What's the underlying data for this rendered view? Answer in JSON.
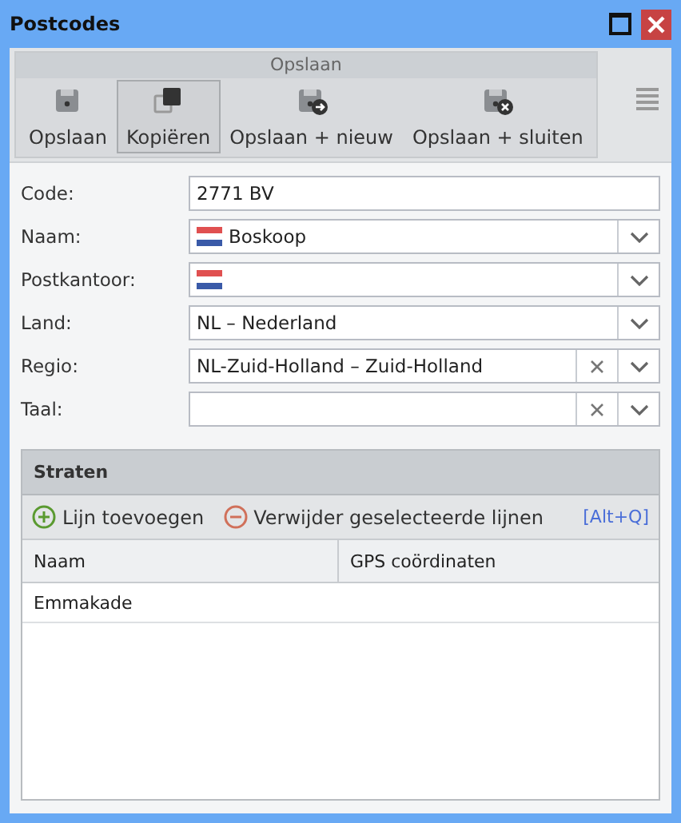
{
  "window": {
    "title": "Postcodes"
  },
  "toolbar": {
    "group_label": "Opslaan",
    "buttons": [
      {
        "label": "Opslaan",
        "kind": "save",
        "selected": false
      },
      {
        "label": "Kopiëren",
        "kind": "copy",
        "selected": true
      },
      {
        "label": "Opslaan + nieuw",
        "kind": "save_new",
        "selected": false
      },
      {
        "label": "Opslaan + sluiten",
        "kind": "save_close",
        "selected": false
      }
    ]
  },
  "fields": [
    {
      "label": "Code:",
      "kind": "text",
      "value": "2771 BV"
    },
    {
      "label": "Naam:",
      "kind": "select",
      "value": "Boskoop",
      "flag": true,
      "clearable": false
    },
    {
      "label": "Postkantoor:",
      "kind": "select",
      "flag": true,
      "clearable": false
    },
    {
      "label": "Land:",
      "kind": "select",
      "value": "NL – Nederland",
      "flag": false,
      "clearable": false
    },
    {
      "label": "Regio:",
      "kind": "select",
      "value": "NL-Zuid-Holland – Zuid-Holland",
      "flag": false,
      "clearable": true
    },
    {
      "label": "Taal:",
      "kind": "select",
      "flag": false,
      "clearable": true
    }
  ],
  "streets": {
    "title": "Straten",
    "add_label": "Lijn toevoegen",
    "remove_label": "Verwijder geselecteerde lijnen",
    "shortcut": "[Alt+Q]",
    "columns": [
      "Naam",
      "GPS coördinaten"
    ],
    "rows": [
      [
        "Emmakade",
        ""
      ]
    ]
  }
}
